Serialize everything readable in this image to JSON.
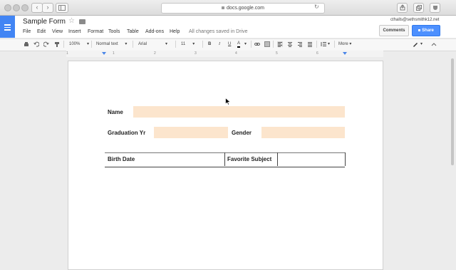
{
  "browser": {
    "url": "docs.google.com",
    "back_glyph": "‹",
    "forward_glyph": "›"
  },
  "docs": {
    "title": "Sample Form",
    "star_glyph": "☆",
    "menu": [
      "File",
      "Edit",
      "View",
      "Insert",
      "Format",
      "Tools",
      "Table",
      "Add-ons",
      "Help"
    ],
    "save_status": "All changes saved in Drive",
    "user_email": "cthalls@sethsmithk12.net",
    "comments_label": "Comments",
    "share_label": "Share"
  },
  "toolbar": {
    "zoom": "100%",
    "style": "Normal text",
    "font": "Arial",
    "size": "11",
    "bold": "B",
    "italic": "I",
    "underline": "U",
    "text_color": "A",
    "more": "More",
    "dropdown_glyph": "▾"
  },
  "ruler": {
    "marks": [
      "1",
      "1",
      "2",
      "3",
      "4",
      "5",
      "6"
    ]
  },
  "form": {
    "name_label": "Name",
    "grad_label": "Graduation Yr",
    "gender_label": "Gender",
    "birth_label": "Birth Date",
    "subject_label": "Favorite Subject",
    "field_color": "#fce5cd"
  },
  "colors": {
    "accent": "#4285f4",
    "share": "#4d90fe"
  }
}
